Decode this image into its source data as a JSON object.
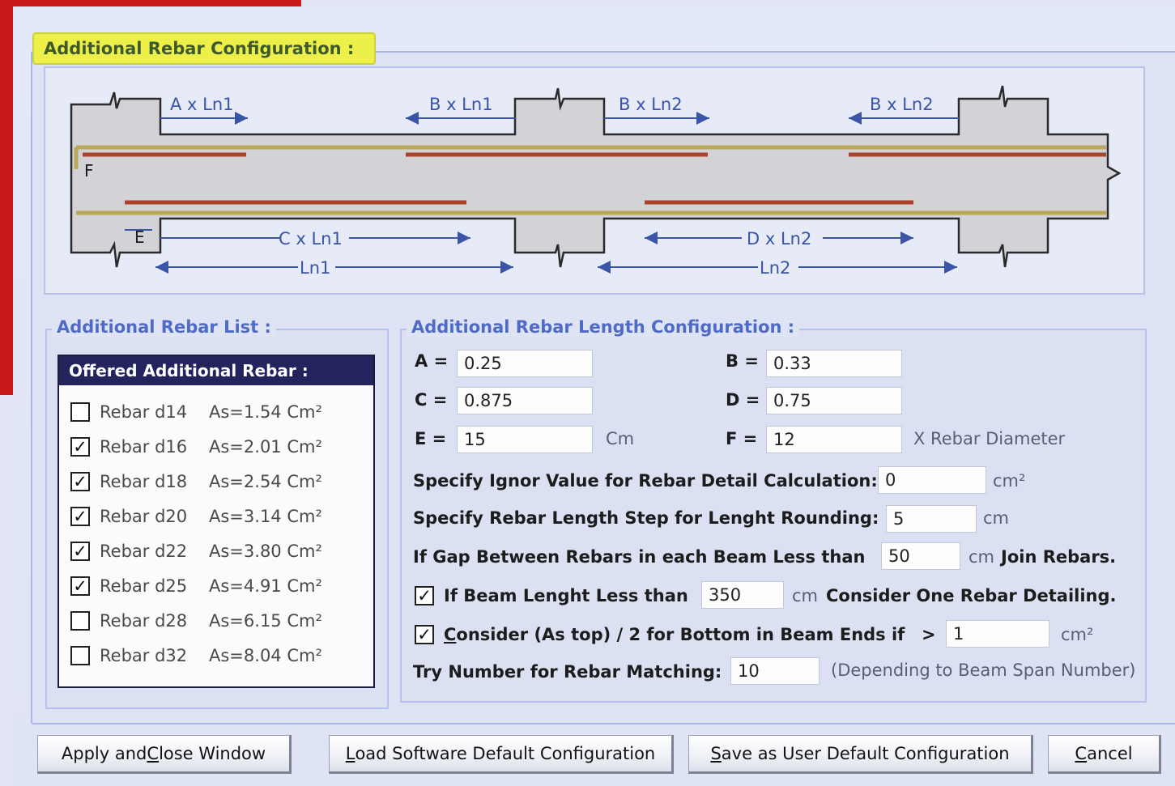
{
  "main_title": "Additional Rebar Configuration :",
  "diagram": {
    "labels": {
      "a_ln1": "A x Ln1",
      "b_ln1": "B x Ln1",
      "b_ln2_left": "B x Ln2",
      "b_ln2_right": "B x Ln2",
      "c_ln1": "C x Ln1",
      "d_ln2": "D x Ln2",
      "ln1": "Ln1",
      "ln2": "Ln2",
      "e": "E",
      "f": "F"
    },
    "colors": {
      "concrete": "#d0d0d4",
      "rebar_main": "#b9a85a",
      "rebar_additional": "#a8432a",
      "dimension": "#3a54a8"
    }
  },
  "rebar_list": {
    "group_label": "Additional Rebar List :",
    "header": "Offered Additional Rebar :",
    "items": [
      {
        "label": "Rebar d14",
        "area": "As=1.54 Cm²",
        "checked": false
      },
      {
        "label": "Rebar d16",
        "area": "As=2.01 Cm²",
        "checked": true
      },
      {
        "label": "Rebar d18",
        "area": "As=2.54 Cm²",
        "checked": true
      },
      {
        "label": "Rebar d20",
        "area": "As=3.14 Cm²",
        "checked": true
      },
      {
        "label": "Rebar d22",
        "area": "As=3.80 Cm²",
        "checked": true
      },
      {
        "label": "Rebar d25",
        "area": "As=4.91 Cm²",
        "checked": true
      },
      {
        "label": "Rebar d28",
        "area": "As=6.15 Cm²",
        "checked": false
      },
      {
        "label": "Rebar d32",
        "area": "As=8.04 Cm²",
        "checked": false
      }
    ]
  },
  "length_config": {
    "group_label": "Additional Rebar Length Configuration :",
    "a": {
      "label": "A =",
      "value": "0.25"
    },
    "b": {
      "label": "B =",
      "value": "0.33"
    },
    "c": {
      "label": "C =",
      "value": "0.875"
    },
    "d": {
      "label": "D =",
      "value": "0.75"
    },
    "e": {
      "label": "E =",
      "value": "15",
      "unit": "Cm"
    },
    "f": {
      "label": "F =",
      "value": "12",
      "unit": "X Rebar Diameter"
    },
    "ignore": {
      "label": "Specify Ignor Value for Rebar Detail Calculation:",
      "value": "0",
      "unit": "cm²"
    },
    "step": {
      "label": "Specify Rebar Length Step for Lenght Rounding:",
      "value": "5",
      "unit": "cm"
    },
    "gap": {
      "label": "If Gap Between Rebars in each Beam Less than",
      "value": "50",
      "unit": "cm",
      "suffix": "Join  Rebars."
    },
    "beam_length": {
      "checked": true,
      "label": "If Beam Lenght Less than",
      "value": "350",
      "unit": "cm",
      "suffix": "Consider One Rebar Detailing."
    },
    "as_top": {
      "checked": true,
      "label_underlined": "C",
      "label_rest": "onsider (As top) / 2 for Bottom in Beam Ends if",
      "op": ">",
      "value": "1",
      "unit": "cm²"
    },
    "try_number": {
      "label": "Try Number for Rebar Matching:",
      "value": "10",
      "note": "(Depending to Beam Span Number)"
    }
  },
  "buttons": {
    "apply": {
      "u": "C",
      "pre": "Apply and ",
      "post": "lose Window"
    },
    "load": {
      "u": "L",
      "pre": "",
      "post": "oad Software Default Configuration"
    },
    "save": {
      "u": "S",
      "pre": "",
      "post": "ave as User Default Configuration"
    },
    "cancel": {
      "u": "C",
      "pre": "",
      "post": "ancel"
    }
  }
}
